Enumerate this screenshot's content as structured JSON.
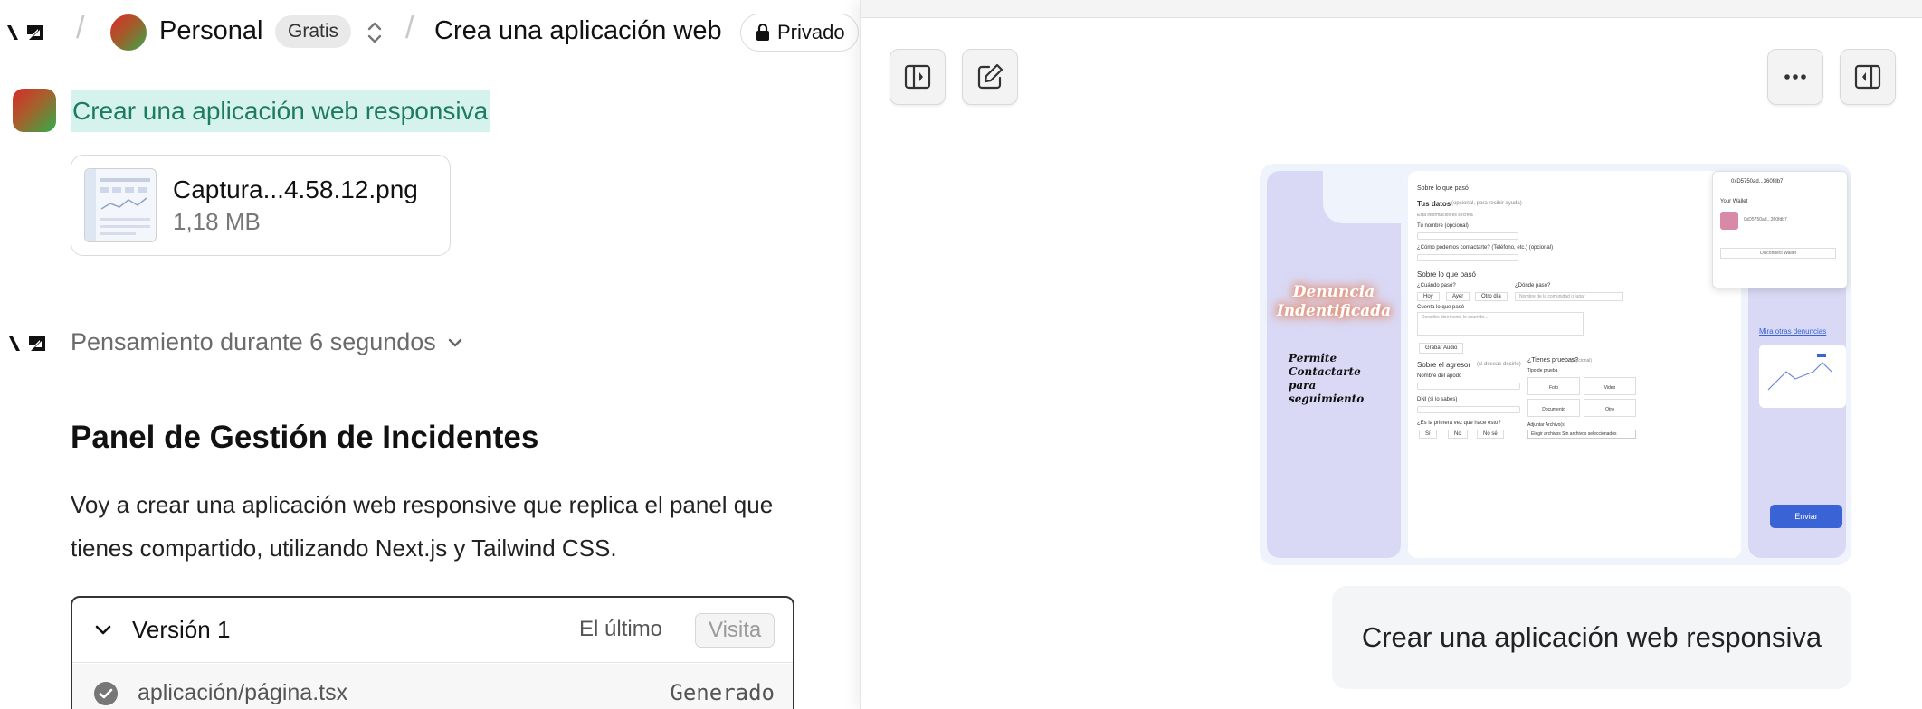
{
  "topbar": {
    "team_name": "Personal",
    "plan_badge": "Gratis",
    "project_title": "Crea una aplicación web",
    "visibility_label": "Privado"
  },
  "chat": {
    "user_message": "Crear una aplicación web responsiva",
    "attachment": {
      "name": "Captura...4.58.12.png",
      "size": "1,18 MB"
    },
    "thinking_label": "Pensamiento durante 6 segundos",
    "heading": "Panel de Gestión de Incidentes",
    "paragraph": "Voy a crear una aplicación web responsive que replica el panel que tienes compartido, utilizando Next.js y Tailwind CSS.",
    "version": {
      "title": "Versión 1",
      "latest_label": "El último",
      "visit_label": "Visita",
      "files": [
        {
          "path": "aplicación/página.tsx",
          "status": "Generado"
        }
      ]
    }
  },
  "preview_pane": {
    "user_bubble": "Crear una aplicación web responsiva",
    "screenshot": {
      "hero_title": "Denuncia Indentificada",
      "hero_subtitle": "Permite Contactarte para seguimiento",
      "form_section": "Sobre lo que pasó",
      "form_your_data": "Tus datos",
      "form_your_data_hint": "(opcional, para recibir ayuda)",
      "form_info_hint": "Esta información es secreta",
      "field_name": "Tu nombre (opcional)",
      "field_contact": "¿Cómo podemos contactarte? (Teléfono, etc.) (opcional)",
      "section_what": "Sobre lo que pasó",
      "when_label": "¿Cuándo pasó?",
      "when_options": [
        "Hoy",
        "Ayer",
        "Otro día"
      ],
      "where_label": "¿Dónde pasó?",
      "where_placeholder": "Nombre de la comunidad o lugar",
      "tell_label": "Cuenta lo que pasó",
      "tell_placeholder": "Describe libremente lo ocurrido...",
      "record_audio": "Grabar Audio",
      "aggressor_title": "Sobre el agresor",
      "aggressor_hint": "(si deseas decirlo)",
      "alias_label": "Nombre del apodo",
      "dni_label": "DNI (si lo sabes)",
      "first_time_label": "¿Es la primera vez que hace esto?",
      "first_time_options": [
        "Sí",
        "No",
        "No sé"
      ],
      "evidence_title": "¿Tienes pruebas?",
      "evidence_hint": "(Opcional)",
      "evidence_type_label": "Tipo de prueba",
      "evidence_types": [
        "Foto",
        "Video",
        "Documento",
        "Otro"
      ],
      "attach_label": "Adjuntar Archivo(s)",
      "attach_value": "Elegir archivos  Sin archivos seleccionados",
      "wallet_address": "0xD5750ad...360fdb7",
      "wallet_title": "Your Wallet",
      "wallet_item": "0xD5750ad...360fdb7",
      "wallet_disconnect": "Disconnect Wallet",
      "see_others": "Mira otras denuncias",
      "submit": "Enviar"
    }
  },
  "colors": {
    "highlight_bg": "#d5f3ec",
    "highlight_text": "#1e7a63",
    "preview_bg": "#eef3fc",
    "lavender": "#d9d9f5",
    "primary_blue": "#3a63d6"
  },
  "icons": [
    "v0-logo-icon",
    "chevron-updown-icon",
    "lock-icon",
    "chevron-down-icon",
    "check-circle-icon",
    "sidebar-toggle-icon",
    "edit-icon",
    "more-icon",
    "panel-right-icon"
  ]
}
